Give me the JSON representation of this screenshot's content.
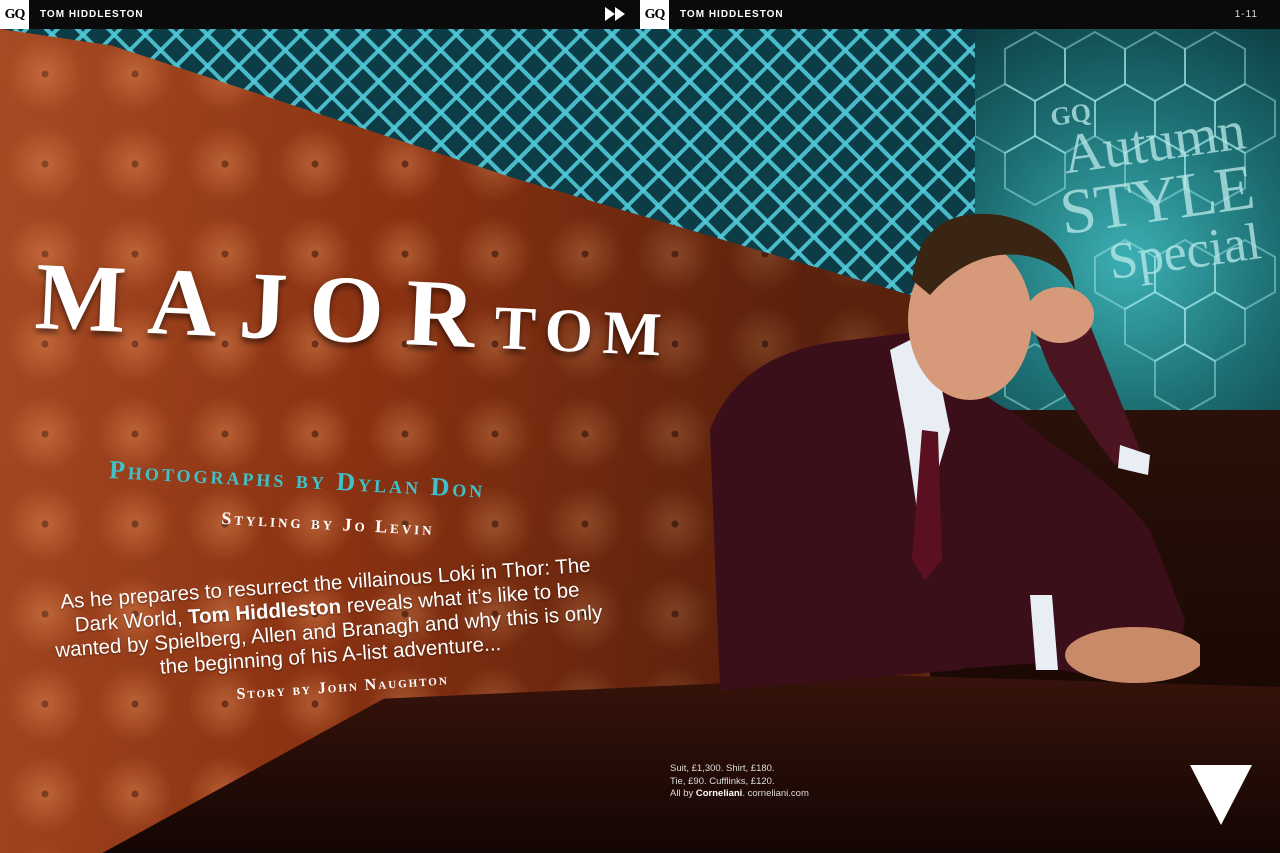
{
  "header": {
    "logo_left": "GQ",
    "title_left": "TOM HIDDLESTON",
    "logo_right": "GQ",
    "title_right": "TOM HIDDLESTON",
    "page_number": "1-11",
    "forward_icon": "fast-forward-icon"
  },
  "cover_text": {
    "gq": "GQ",
    "line1": "Autumn",
    "line2": "STYLE",
    "line3": "Special"
  },
  "headline": {
    "word1": "MAJOR",
    "word2": "TOM"
  },
  "credits": {
    "photographs": "Photographs by Dylan Don",
    "styling": "Styling by Jo Levin",
    "story": "Story by John Naughton"
  },
  "standfirst": {
    "part1": "As he prepares to resurrect the villainous Loki in Thor: The Dark World, ",
    "bold_name": "Tom Hiddleston",
    "part2": " reveals what it’s like to be wanted by Spielberg, Allen and Branagh and why this is only the beginning of his A-list adventure..."
  },
  "caption": {
    "line1": "Suit, £1,300. Shirt, £180.",
    "line2": "Tie, £90. Cufflinks, £120.",
    "line3_prefix": "All by ",
    "brand": "Corneliani",
    "line3_suffix": ". corneliani.com"
  },
  "icons": {
    "next_page": "down-triangle-icon"
  }
}
